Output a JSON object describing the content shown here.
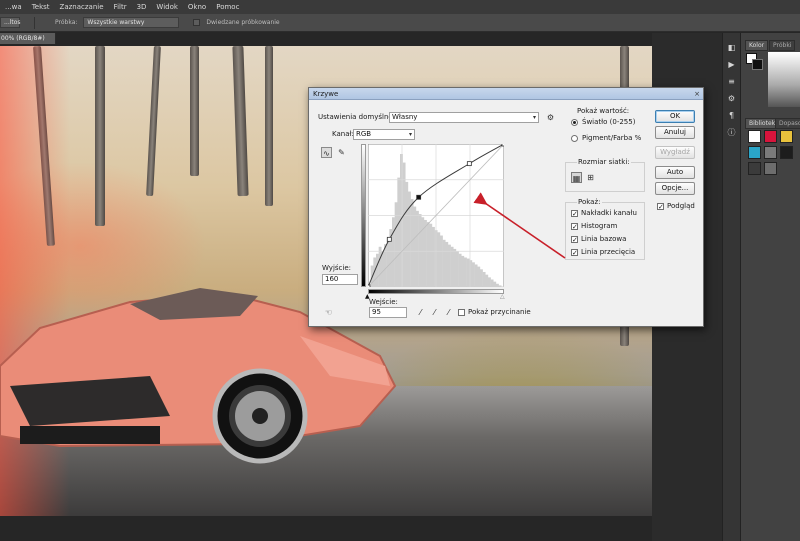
{
  "menubar": {
    "items": [
      "...wa",
      "Tekst",
      "Zaznaczanie",
      "Filtr",
      "3D",
      "Widok",
      "Okno",
      "Pomoc"
    ]
  },
  "optionsbar": {
    "mode_value": "...ltos",
    "sample_label": "Próbka:",
    "sample_value": "Wszystkie warstwy",
    "enhance_label": "Dwiedzane próbkowanie"
  },
  "document": {
    "tab_label": "00% (RGB/8#)"
  },
  "panels": {
    "color_tab": "Kolor",
    "swatches_tab": "Próbki",
    "libraries_tab": "Biblioteki",
    "adjustments_tab": "Dopasowa...",
    "swatch_colors": [
      "#ffffff",
      "#d8143c",
      "#e9c23c",
      "#2aa5c8",
      "#7a7a7a",
      "#1d1d1d",
      "#3b3b3b",
      "#6d6d6d"
    ]
  },
  "dialog": {
    "title": "Krzywe",
    "close_glyph": "×",
    "preset_label": "Ustawienia domyślne:",
    "preset_value": "Własny",
    "channel_label": "Kanał:",
    "channel_value": "RGB",
    "output_label": "Wyjście:",
    "output_value": "160",
    "input_label": "Wejście:",
    "input_value": "95",
    "show_clipping_label": "Pokaż przycinanie",
    "buttons": {
      "ok": "OK",
      "cancel": "Anuluj",
      "smooth": "Wygładź",
      "auto": "Auto",
      "options": "Opcje..."
    },
    "preview_label": "Podgląd",
    "show_amount": {
      "title": "Pokaż wartość:",
      "light": "Światło (0-255)",
      "pigment": "Pigment/Farba %"
    },
    "grid_size_title": "Rozmiar siatki:",
    "show_group": {
      "title": "Pokaż:",
      "items": [
        "Nakładki kanału",
        "Histogram",
        "Linia bazowa",
        "Linia przecięcia"
      ]
    }
  },
  "accent": {
    "annotation_arrow": "#c8202a",
    "dialog_title_bg": "#b0c6e3",
    "default_button_border": "#3c7fb1"
  },
  "chart_data": {
    "type": "line",
    "curve_points": [
      [
        0,
        0
      ],
      [
        40,
        85
      ],
      [
        95,
        160
      ],
      [
        190,
        220
      ],
      [
        255,
        255
      ]
    ],
    "histogram_levels": [
      0,
      40,
      55,
      62,
      75,
      66,
      80,
      92,
      108,
      130,
      158,
      204,
      248,
      232,
      196,
      178,
      164,
      150,
      142,
      136,
      130,
      125,
      121,
      118,
      112,
      106,
      102,
      96,
      88,
      84,
      79,
      75,
      71,
      66,
      62,
      58,
      55,
      53,
      50,
      46,
      42,
      38,
      33,
      28,
      23,
      18,
      14,
      10,
      6,
      3,
      1
    ],
    "xlim": [
      0,
      255
    ],
    "ylim": [
      0,
      255
    ],
    "grid": "4x4"
  }
}
